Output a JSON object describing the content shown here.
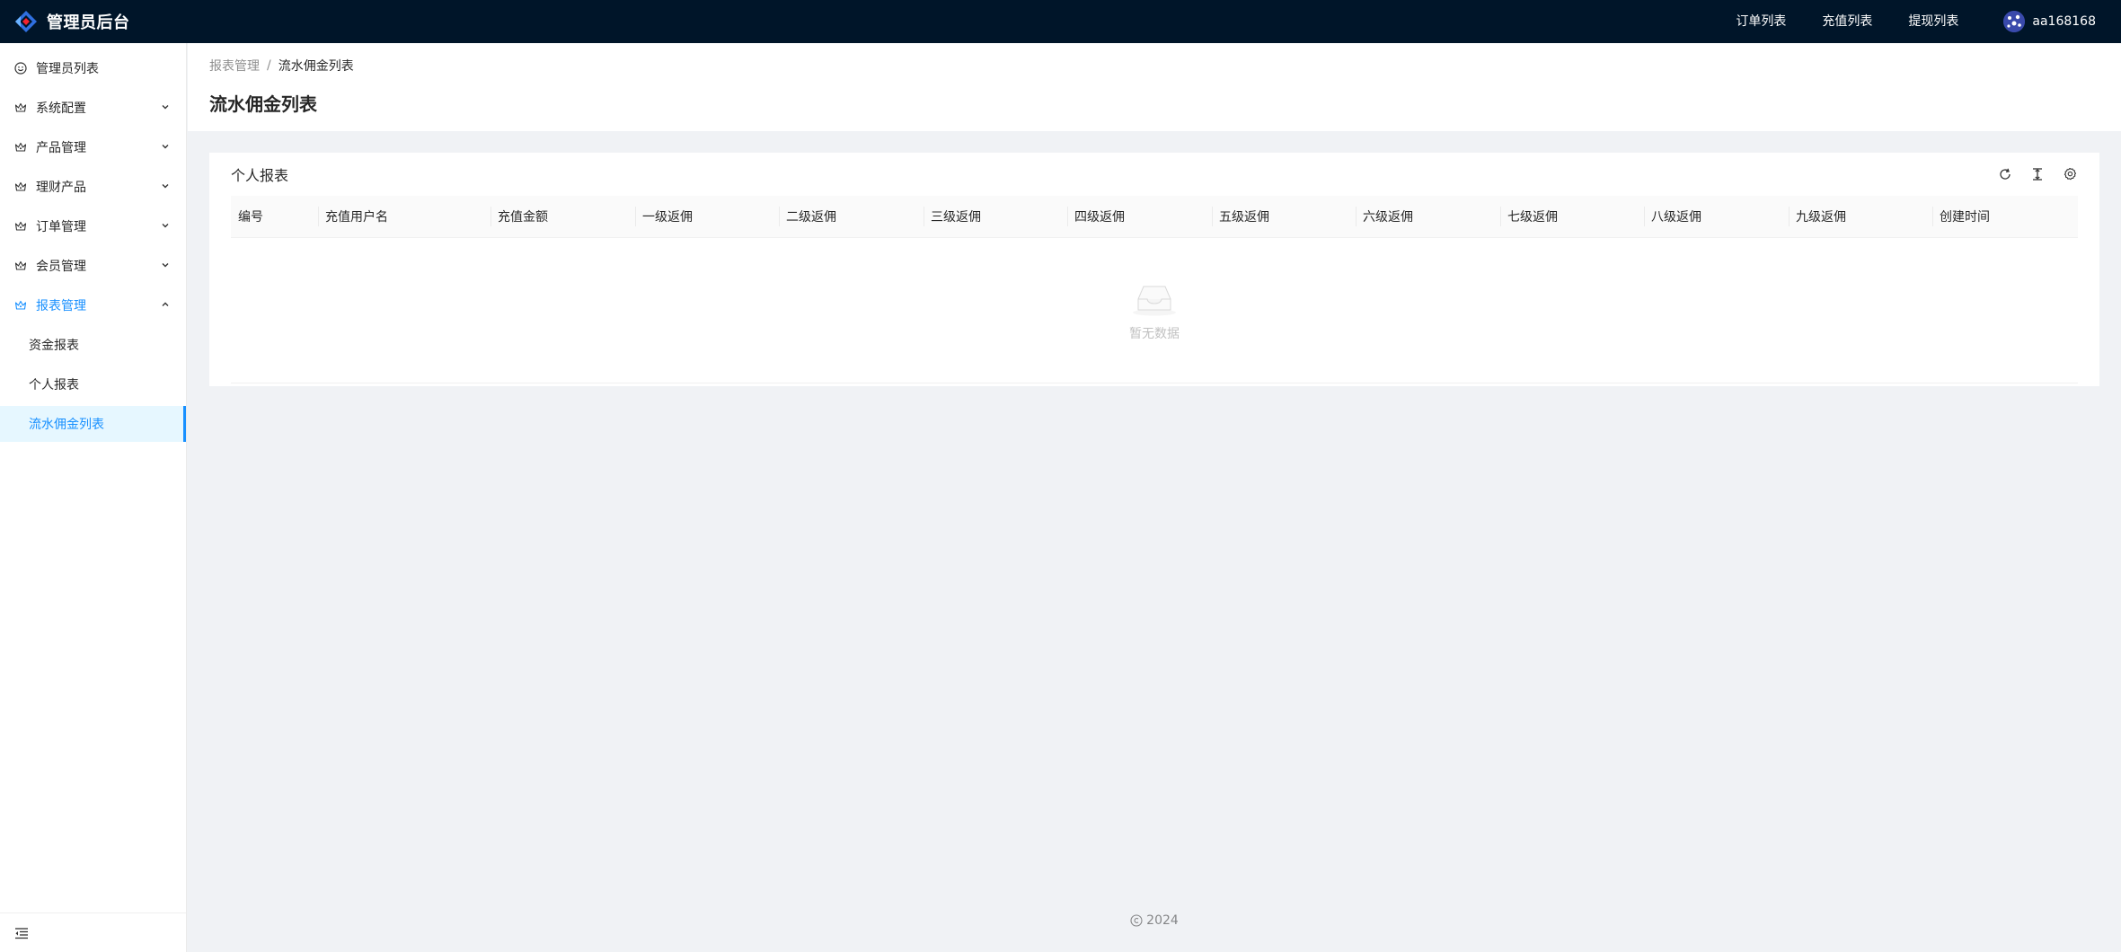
{
  "header": {
    "title": "管理员后台",
    "links": [
      "订单列表",
      "充值列表",
      "提现列表"
    ],
    "user_name": "aa168168"
  },
  "sidebar": {
    "items": [
      {
        "label": "管理员列表",
        "icon": "smile-icon",
        "has_children": false
      },
      {
        "label": "系统配置",
        "icon": "crown-icon",
        "has_children": true
      },
      {
        "label": "产品管理",
        "icon": "crown-icon",
        "has_children": true
      },
      {
        "label": "理财产品",
        "icon": "crown-icon",
        "has_children": true
      },
      {
        "label": "订单管理",
        "icon": "crown-icon",
        "has_children": true
      },
      {
        "label": "会员管理",
        "icon": "crown-icon",
        "has_children": true
      },
      {
        "label": "报表管理",
        "icon": "crown-icon",
        "has_children": true,
        "open": true
      }
    ],
    "sub_items": [
      "资金报表",
      "个人报表",
      "流水佣金列表"
    ],
    "active_sub": "流水佣金列表"
  },
  "page": {
    "breadcrumb": [
      "报表管理",
      "流水佣金列表"
    ],
    "title": "流水佣金列表"
  },
  "card": {
    "title": "个人报表",
    "toolbar_icons": [
      "reload-icon",
      "column-height-icon",
      "setting-icon"
    ]
  },
  "table": {
    "columns": [
      "编号",
      "充值用户名",
      "充值金额",
      "一级返佣",
      "二级返佣",
      "三级返佣",
      "四级返佣",
      "五级返佣",
      "六级返佣",
      "七级返佣",
      "八级返佣",
      "九级返佣",
      "创建时间"
    ],
    "empty_text": "暂无数据"
  },
  "footer": {
    "copyright": "2024"
  },
  "colors": {
    "header_bg": "#001529",
    "primary": "#1890ff",
    "active_bg": "#e6f7ff",
    "page_bg": "#f0f2f5"
  }
}
